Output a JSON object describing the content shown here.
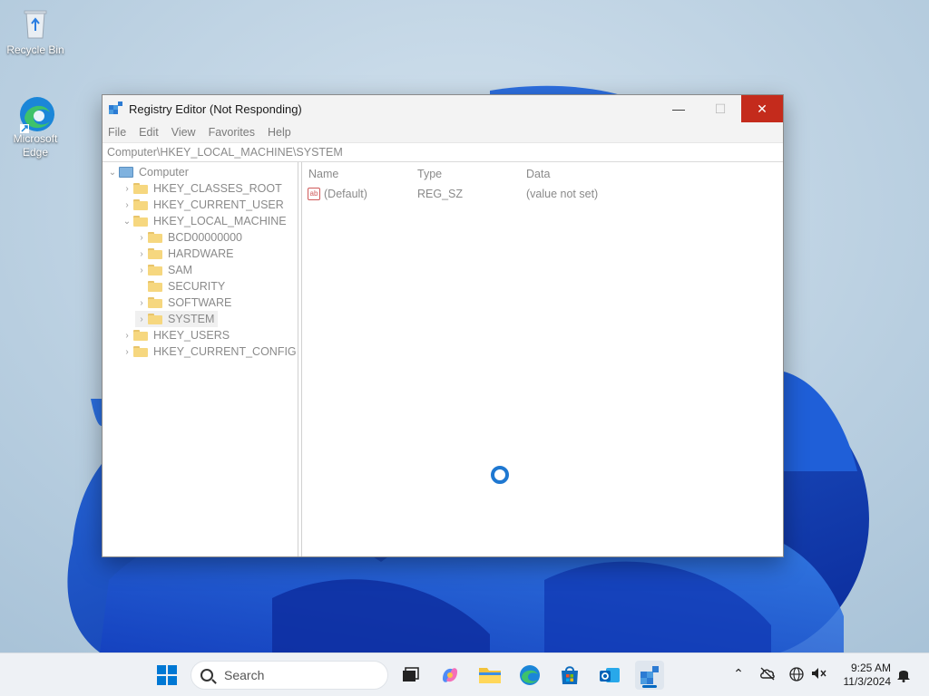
{
  "desktop": {
    "icons": [
      {
        "label": "Recycle Bin"
      },
      {
        "label": "Microsoft Edge"
      }
    ]
  },
  "window": {
    "title": "Registry Editor (Not Responding)",
    "controls": {
      "minimize": "—",
      "maximize": "☐",
      "close": "✕"
    },
    "menu": [
      "File",
      "Edit",
      "View",
      "Favorites",
      "Help"
    ],
    "address": "Computer\\HKEY_LOCAL_MACHINE\\SYSTEM",
    "tree": {
      "root": "Computer",
      "hives": [
        {
          "label": "HKEY_CLASSES_ROOT"
        },
        {
          "label": "HKEY_CURRENT_USER"
        },
        {
          "label": "HKEY_LOCAL_MACHINE"
        },
        {
          "label": "HKEY_USERS"
        },
        {
          "label": "HKEY_CURRENT_CONFIG"
        }
      ],
      "hklm_children": [
        {
          "label": "BCD00000000"
        },
        {
          "label": "HARDWARE"
        },
        {
          "label": "SAM"
        },
        {
          "label": "SECURITY"
        },
        {
          "label": "SOFTWARE"
        },
        {
          "label": "SYSTEM"
        }
      ]
    },
    "list": {
      "columns": [
        "Name",
        "Type",
        "Data"
      ],
      "rows": [
        {
          "name": "(Default)",
          "type": "REG_SZ",
          "data": "(value not set)"
        }
      ]
    }
  },
  "taskbar": {
    "search_placeholder": "Search",
    "clock_time": "9:25 AM",
    "clock_date": "11/3/2024"
  },
  "colors": {
    "accent": "#0067c0",
    "close_button": "#c42b1c",
    "spinner": "#1f78d1"
  }
}
